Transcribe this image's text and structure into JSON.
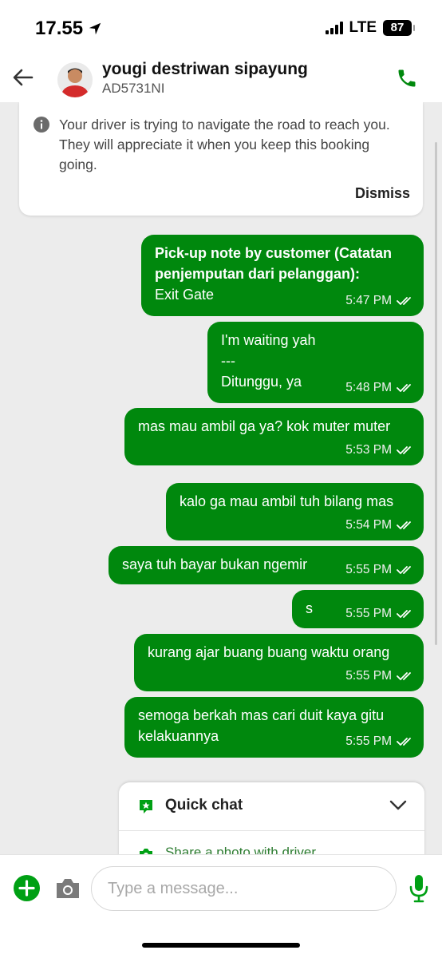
{
  "status_bar": {
    "time": "17.55",
    "network": "LTE",
    "battery": "87"
  },
  "header": {
    "driver_name": "yougi destriwan sipayung",
    "plate": "AD5731NI"
  },
  "notice": {
    "text": "Your driver is trying to navigate the road to reach you. They will appreciate it when you keep this booking going.",
    "dismiss_label": "Dismiss"
  },
  "messages": [
    {
      "lines": [
        "Pick-up note by customer (Catatan",
        "penjemputan dari pelanggan):"
      ],
      "body": "Exit Gate",
      "time": "5:47 PM"
    },
    {
      "lines": [
        "I'm waiting yah",
        "---",
        "Ditunggu, ya"
      ],
      "time": "5:48 PM"
    },
    {
      "lines": [
        "mas mau ambil ga ya? kok muter muter"
      ],
      "time": "5:53 PM"
    },
    {
      "lines": [
        "kalo ga mau ambil tuh bilang mas"
      ],
      "time": "5:54 PM"
    },
    {
      "lines": [
        "saya tuh bayar bukan ngemir"
      ],
      "time": "5:55 PM"
    },
    {
      "lines": [
        "s"
      ],
      "time": "5:55 PM"
    },
    {
      "lines": [
        "kurang ajar buang buang waktu orang"
      ],
      "time": "5:55 PM"
    },
    {
      "lines": [
        "semoga berkah mas cari duit kaya gitu",
        "kelakuannya"
      ],
      "time": "5:55 PM"
    }
  ],
  "quick_chat": {
    "title": "Quick chat",
    "item": "Share a photo with driver"
  },
  "input": {
    "placeholder": "Type a message..."
  },
  "icons": {
    "back": "back-arrow-icon",
    "call": "phone-icon",
    "info": "info-icon",
    "read": "double-check-icon",
    "quick_chat": "chat-star-icon",
    "add": "plus-icon",
    "camera": "camera-icon",
    "mic": "microphone-icon"
  },
  "colors": {
    "brand_green": "#00880d",
    "chat_background": "#ececec"
  }
}
